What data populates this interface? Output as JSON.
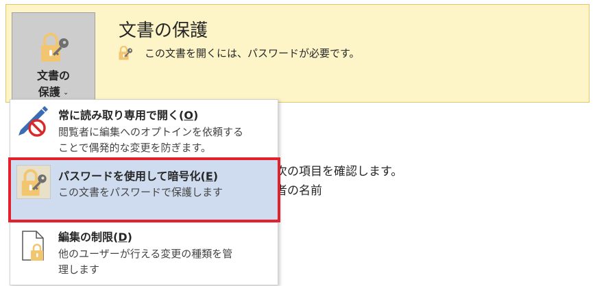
{
  "protect": {
    "button_line1": "文書の",
    "button_line2": "保護",
    "button_caret": "⌄",
    "button_icon": "lock-key-icon",
    "title": "文書の保護",
    "status_icon": "lock-key-icon",
    "status_text": "この文書を開くには、パスワードが必要です。"
  },
  "background": {
    "line1": "次の項目を確認します。",
    "line2": "者の名前"
  },
  "menu": {
    "items": [
      {
        "title_prefix": "常に読み取り専用で開く(",
        "accel": "O",
        "title_suffix": ")",
        "desc_line1": "閲覧者に編集へのオプトインを依頼する",
        "desc_line2": "ことで偶発的な変更を防ぎます。",
        "icon": "pen-no-icon"
      },
      {
        "title_prefix": "パスワードを使用して暗号化(",
        "accel": "E",
        "title_suffix": ")",
        "desc_line1": "この文書をパスワードで保護します",
        "icon": "lock-key-icon"
      },
      {
        "title_prefix": "編集の制限(",
        "accel": "D",
        "title_suffix": ")",
        "desc_line1": "他のユーザーが行える変更の種類を管",
        "desc_line2": "理します",
        "icon": "document-lock-icon"
      }
    ]
  },
  "colors": {
    "panel_bg": "#fdf4c8",
    "panel_border": "#e5c565",
    "button_bg": "#cdcdcd",
    "selected_item_bg": "#cfdcef",
    "highlight_frame": "#e3202b",
    "lock_gold": "#f2c571"
  }
}
